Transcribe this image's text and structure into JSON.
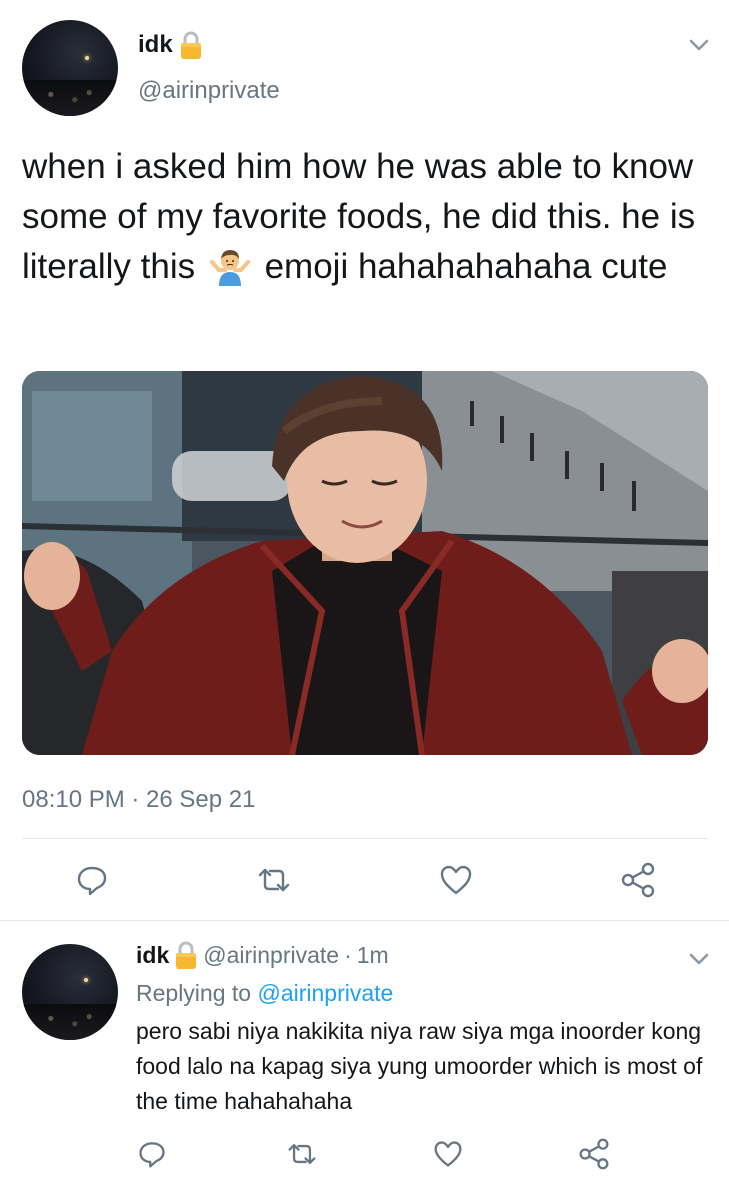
{
  "main_tweet": {
    "display_name": "idk",
    "handle": "@airinprivate",
    "text_before_emoji": "when i asked him how he was able to know some of my favorite foods, he did this. he is literally this",
    "emoji": "person-shrugging-emoji",
    "text_after_emoji": "emoji hahahahahaha cute",
    "timestamp": "08:10 PM · 26 Sep 21",
    "media": "photo of a smiling young man in a red jacket shrugging with eyes closed",
    "actions": [
      "reply-icon",
      "retweet-icon",
      "like-icon",
      "share-icon"
    ]
  },
  "reply_tweet": {
    "display_name": "idk",
    "handle": "@airinprivate",
    "dot": "·",
    "time": "1m",
    "replying_to_label": "Replying to",
    "replying_to_handle": "@airinprivate",
    "text": "pero sabi niya nakikita niya raw siya mga inoorder kong food lalo na kapag siya yung umoorder which is most of the time hahahahaha",
    "actions": [
      "reply-icon",
      "retweet-icon",
      "like-icon",
      "share-icon"
    ]
  },
  "colors": {
    "primary_text": "#14171a",
    "secondary_text": "#657786",
    "link": "#1da1f2",
    "divider": "#e1e8ed",
    "lock": "#f5b82e"
  }
}
